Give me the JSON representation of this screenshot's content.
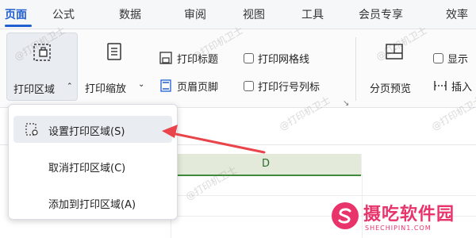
{
  "ribbon_tabs": [
    "页面",
    "公式",
    "数据",
    "审阅",
    "视图",
    "工具",
    "会员专享",
    "效率"
  ],
  "active_tab": "页面",
  "ribbon": {
    "print_area": "打印区域",
    "print_zoom": "打印缩放",
    "print_titles": "打印标题",
    "header_footer": "页眉页脚",
    "print_gridlines": "打印网格线",
    "print_row_col_headers": "打印行号列标",
    "page_break_preview": "分页预览",
    "show_partial": "显示",
    "insert_partial": "插入"
  },
  "print_area_menu": {
    "items": [
      "设置打印区域(S)",
      "取消打印区域(C)",
      "添加到打印区域(A)"
    ],
    "highlighted_item": "设置打印区域(S)"
  },
  "sheet": {
    "column_label": "D"
  },
  "watermark": {
    "text": "@打印机卫士"
  },
  "logo": {
    "name": "摄吃软件园",
    "url_text": "SHECHIPIN1.COM"
  },
  "colors": {
    "accent": "#1f5fcf",
    "arrow": "#e8444a",
    "logo": "#e8336b",
    "column_green": "#3f8a3d"
  }
}
